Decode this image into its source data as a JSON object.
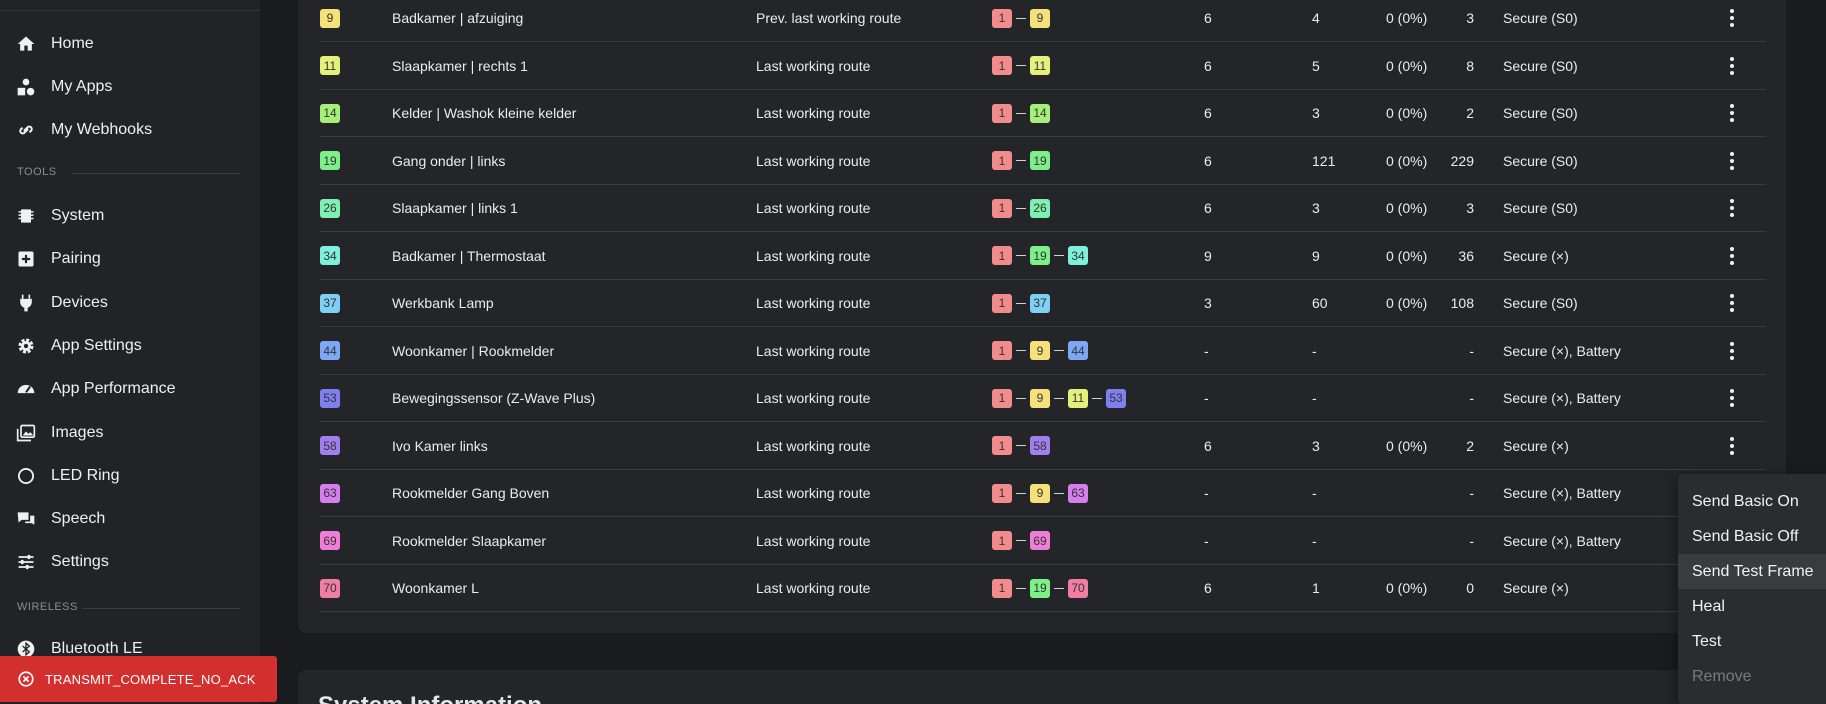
{
  "sidebar": {
    "items": [
      {
        "label": "Home",
        "icon": "home-icon"
      },
      {
        "label": "My Apps",
        "icon": "apps-icon"
      },
      {
        "label": "My Webhooks",
        "icon": "webhook-icon"
      },
      {
        "label": "System",
        "icon": "chip-icon"
      },
      {
        "label": "Pairing",
        "icon": "plus-box-icon"
      },
      {
        "label": "Devices",
        "icon": "plug-icon"
      },
      {
        "label": "App Settings",
        "icon": "gear-icon"
      },
      {
        "label": "App Performance",
        "icon": "gauge-icon"
      },
      {
        "label": "Images",
        "icon": "images-icon"
      },
      {
        "label": "LED Ring",
        "icon": "ring-icon"
      },
      {
        "label": "Speech",
        "icon": "speech-icon"
      },
      {
        "label": "Settings",
        "icon": "sliders-icon"
      },
      {
        "label": "Bluetooth LE",
        "icon": "bluetooth-icon"
      }
    ],
    "sections": {
      "tools": "TOOLS",
      "wireless": "WIRELESS"
    }
  },
  "toast": {
    "text": "TRANSMIT_COMPLETE_NO_ACK",
    "color": "#d32f2f"
  },
  "badge_colors": {
    "1": "#f28b8b",
    "9": "#f5e07a",
    "11": "#e5f07a",
    "14": "#a6f07a",
    "19": "#7ef08a",
    "26": "#7ef0b2",
    "34": "#7ef0de",
    "37": "#7ed0f5",
    "44": "#7ea8f5",
    "53": "#7e80f0",
    "58": "#a07ef0",
    "63": "#d47ef0",
    "69": "#f07ed8",
    "70": "#f07ea0"
  },
  "rows": [
    {
      "id": "9",
      "name": "Badkamer | afzuiging",
      "route_type": "Prev. last working route",
      "route": [
        "1",
        "9"
      ],
      "c1": "6",
      "c2": "4",
      "c3": "0 (0%)",
      "c4": "3",
      "security": "Secure (S0)"
    },
    {
      "id": "11",
      "name": "Slaapkamer | rechts 1",
      "route_type": "Last working route",
      "route": [
        "1",
        "11"
      ],
      "c1": "6",
      "c2": "5",
      "c3": "0 (0%)",
      "c4": "8",
      "security": "Secure (S0)"
    },
    {
      "id": "14",
      "name": "Kelder | Washok kleine kelder",
      "route_type": "Last working route",
      "route": [
        "1",
        "14"
      ],
      "c1": "6",
      "c2": "3",
      "c3": "0 (0%)",
      "c4": "2",
      "security": "Secure (S0)"
    },
    {
      "id": "19",
      "name": "Gang onder | links",
      "route_type": "Last working route",
      "route": [
        "1",
        "19"
      ],
      "c1": "6",
      "c2": "121",
      "c3": "0 (0%)",
      "c4": "229",
      "security": "Secure (S0)"
    },
    {
      "id": "26",
      "name": "Slaapkamer | links 1",
      "route_type": "Last working route",
      "route": [
        "1",
        "26"
      ],
      "c1": "6",
      "c2": "3",
      "c3": "0 (0%)",
      "c4": "3",
      "security": "Secure (S0)"
    },
    {
      "id": "34",
      "name": "Badkamer | Thermostaat",
      "route_type": "Last working route",
      "route": [
        "1",
        "19",
        "34"
      ],
      "c1": "9",
      "c2": "9",
      "c3": "0 (0%)",
      "c4": "36",
      "security": "Secure (×)"
    },
    {
      "id": "37",
      "name": "Werkbank Lamp",
      "route_type": "Last working route",
      "route": [
        "1",
        "37"
      ],
      "c1": "3",
      "c2": "60",
      "c3": "0 (0%)",
      "c4": "108",
      "security": "Secure (S0)"
    },
    {
      "id": "44",
      "name": "Woonkamer | Rookmelder",
      "route_type": "Last working route",
      "route": [
        "1",
        "9",
        "44"
      ],
      "c1": "-",
      "c2": "-",
      "c3": "",
      "c4": "-",
      "security": "Secure (×), Battery"
    },
    {
      "id": "53",
      "name": "Bewegingssensor (Z-Wave Plus)",
      "route_type": "Last working route",
      "route": [
        "1",
        "9",
        "11",
        "53"
      ],
      "c1": "-",
      "c2": "-",
      "c3": "",
      "c4": "-",
      "security": "Secure (×), Battery"
    },
    {
      "id": "58",
      "name": "Ivo Kamer links",
      "route_type": "Last working route",
      "route": [
        "1",
        "58"
      ],
      "c1": "6",
      "c2": "3",
      "c3": "0 (0%)",
      "c4": "2",
      "security": "Secure (×)"
    },
    {
      "id": "63",
      "name": "Rookmelder Gang Boven",
      "route_type": "Last working route",
      "route": [
        "1",
        "9",
        "63"
      ],
      "c1": "-",
      "c2": "-",
      "c3": "",
      "c4": "-",
      "security": "Secure (×), Battery"
    },
    {
      "id": "69",
      "name": "Rookmelder Slaapkamer",
      "route_type": "Last working route",
      "route": [
        "1",
        "69"
      ],
      "c1": "-",
      "c2": "-",
      "c3": "",
      "c4": "-",
      "security": "Secure (×), Battery"
    },
    {
      "id": "70",
      "name": "Woonkamer L",
      "route_type": "Last working route",
      "route": [
        "1",
        "19",
        "70"
      ],
      "c1": "6",
      "c2": "1",
      "c3": "0 (0%)",
      "c4": "0",
      "security": "Secure (×)"
    }
  ],
  "menu": {
    "items": [
      {
        "label": "Send Basic On"
      },
      {
        "label": "Send Basic Off"
      },
      {
        "label": "Send Test Frame"
      },
      {
        "label": "Heal"
      },
      {
        "label": "Test"
      },
      {
        "label": "Remove"
      }
    ]
  },
  "section2": {
    "title": "System Information"
  }
}
